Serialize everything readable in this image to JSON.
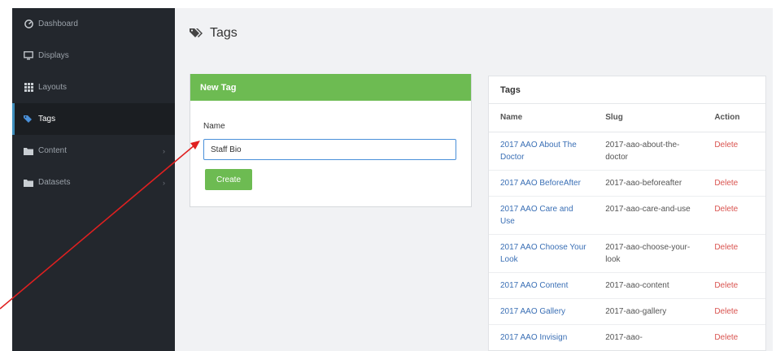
{
  "sidebar": {
    "items": [
      {
        "label": "Dashboard",
        "icon": "dashboard-icon"
      },
      {
        "label": "Displays",
        "icon": "monitor-icon"
      },
      {
        "label": "Layouts",
        "icon": "grid-icon"
      },
      {
        "label": "Tags",
        "icon": "tags-icon",
        "active": true
      },
      {
        "label": "Content",
        "icon": "folder-icon",
        "chevron": "›"
      },
      {
        "label": "Datasets",
        "icon": "folder-icon",
        "chevron": "›"
      }
    ]
  },
  "page": {
    "title": "Tags"
  },
  "new_tag": {
    "header": "New Tag",
    "name_label": "Name",
    "name_value": "Staff Bio",
    "create_label": "Create"
  },
  "tags_table": {
    "header": "Tags",
    "columns": [
      "Name",
      "Slug",
      "Action"
    ],
    "rows": [
      {
        "name": "2017 AAO About The Doctor",
        "slug": "2017-aao-about-the-doctor",
        "action": "Delete"
      },
      {
        "name": "2017 AAO BeforeAfter",
        "slug": "2017-aao-beforeafter",
        "action": "Delete"
      },
      {
        "name": "2017 AAO Care and Use",
        "slug": "2017-aao-care-and-use",
        "action": "Delete"
      },
      {
        "name": "2017 AAO Choose Your Look",
        "slug": "2017-aao-choose-your-look",
        "action": "Delete"
      },
      {
        "name": "2017 AAO Content",
        "slug": "2017-aao-content",
        "action": "Delete"
      },
      {
        "name": "2017 AAO Gallery",
        "slug": "2017-aao-gallery",
        "action": "Delete"
      },
      {
        "name": "2017 AAO Invisign",
        "slug": "2017-aao-",
        "action": "Delete"
      }
    ]
  },
  "colors": {
    "sidebar_bg": "#23272d",
    "accent_green": "#6dbb52",
    "link_blue": "#3a6fb5",
    "delete_red": "#d9534f",
    "annotation_red": "#e02020"
  }
}
